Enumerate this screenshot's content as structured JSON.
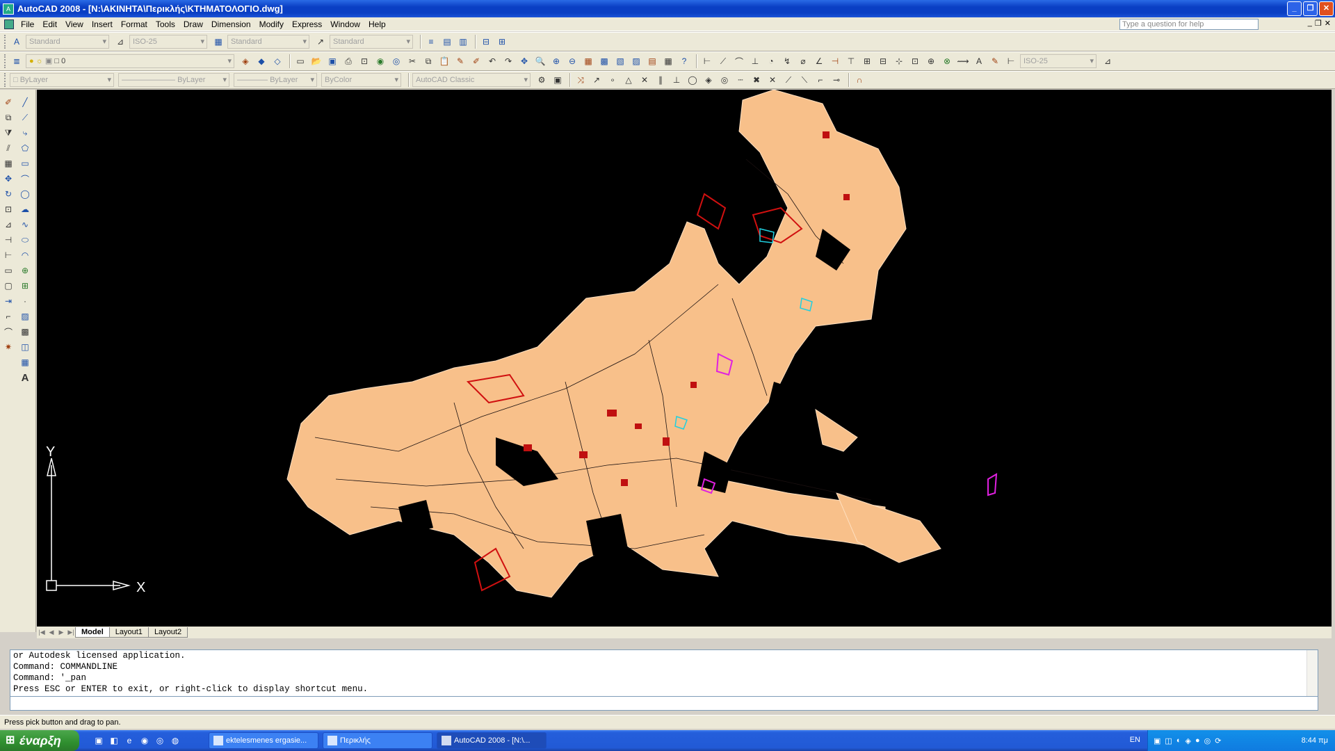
{
  "window": {
    "title": "AutoCAD 2008 - [N:\\ΑΚΙΝΗΤΑ\\Περικλής\\ΚΤΗΜΑΤΟΛΟΓΙΟ.dwg]",
    "controls": [
      "_",
      "❐",
      "✕"
    ]
  },
  "menu": {
    "items": [
      "File",
      "Edit",
      "View",
      "Insert",
      "Format",
      "Tools",
      "Draw",
      "Dimension",
      "Modify",
      "Express",
      "Window",
      "Help"
    ],
    "help_placeholder": "Type a question for help"
  },
  "toolbar1": {
    "text_style": "Standard",
    "dim_style": "ISO-25",
    "table_style": "Standard",
    "mleader_style": "Standard"
  },
  "toolbar2": {
    "layer": "0",
    "dim_style_right": "ISO-25"
  },
  "toolbar3": {
    "color": "ByLayer",
    "linetype": "ByLayer",
    "lineweight": "ByLayer",
    "plotstyle": "ByColor",
    "workspace": "AutoCAD Classic"
  },
  "ucs": {
    "x_label": "X",
    "y_label": "Y"
  },
  "tabs": [
    "Model",
    "Layout1",
    "Layout2"
  ],
  "command_history": [
    "or Autodesk licensed application.",
    "Command: COMMANDLINE",
    "Command: '_pan",
    "Press ESC or ENTER to exit, or right-click to display shortcut menu."
  ],
  "status": "Press pick button and drag to pan.",
  "taskbar": {
    "start_label": "έναρξη",
    "tasks": [
      "ektelesmenes ergasie...",
      "Περικλής",
      "AutoCAD 2008 - [N:\\..."
    ],
    "language": "EN",
    "clock": "8:44 πμ"
  },
  "colors": {
    "map_fill": "#f8c08a",
    "map_red": "#d01010",
    "map_magenta": "#e020e0",
    "map_cyan": "#20d0e0",
    "canvas_bg": "#000000",
    "title_blue": "#0a3fc4"
  }
}
